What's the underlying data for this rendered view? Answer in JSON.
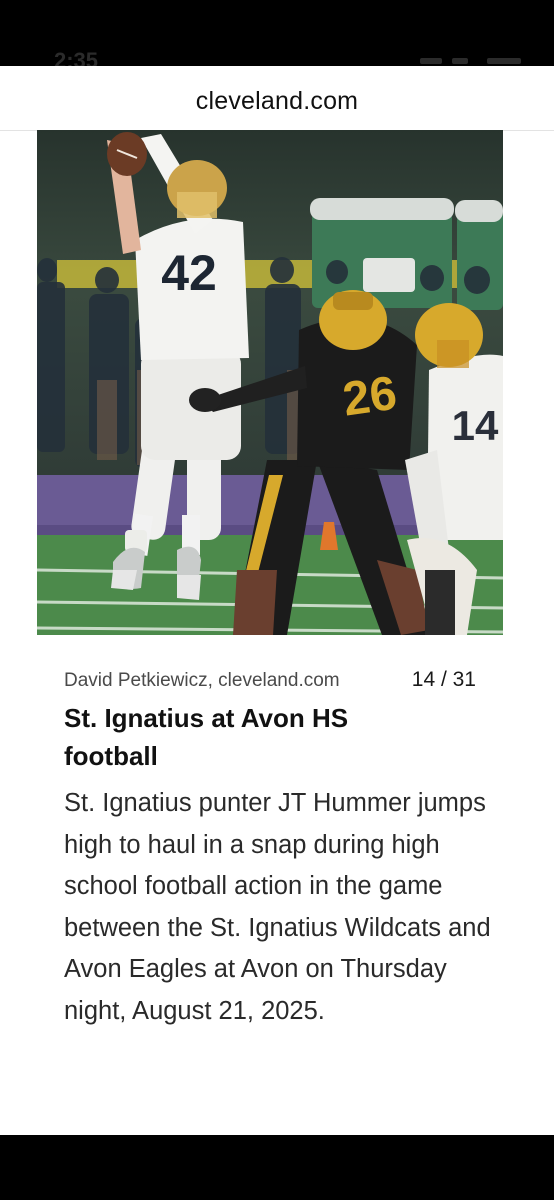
{
  "status_bar": {
    "time": "2:35"
  },
  "browser": {
    "domain": "cleveland.com"
  },
  "gallery": {
    "credit": "David Petkiewicz, cleveland.com",
    "counter": "14 / 31",
    "title": "St. Ignatius at Avon HS football",
    "caption": "St. Ignatius punter JT Hummer jumps high to haul in a snap during high school football action in the game between the St. Ignatius Wildcats and Avon Eagles at Avon on Thursday night, August 21, 2025.",
    "photo": {
      "jersey_number_white": "42",
      "jersey_number_dark": "26",
      "jersey_number_partial": "14"
    }
  },
  "colors": {
    "turf": "#4c8a4b",
    "track": "#6a5b94",
    "gold": "#d7a92c",
    "dark_jersey": "#1b1b1b"
  }
}
